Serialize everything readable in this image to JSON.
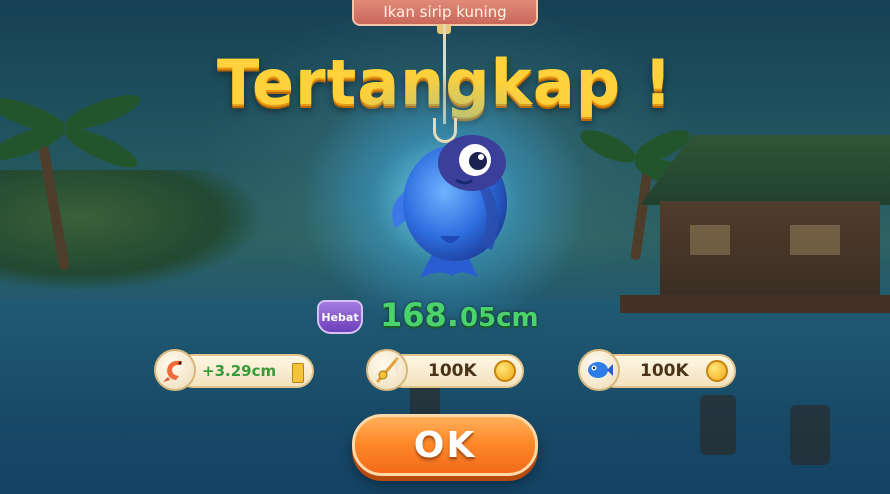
{
  "fish_name": "Ikan sirip kuning",
  "headline": "Tertangkap !",
  "rarity_badge": "Hebat",
  "length": {
    "integer": "168.",
    "decimal": "05cm"
  },
  "rewards": {
    "bait": {
      "icon": "shrimp-icon",
      "value": "+3.29cm"
    },
    "rod": {
      "icon": "fishing-rod-icon",
      "value": "100K"
    },
    "fish": {
      "icon": "blue-fish-icon",
      "value": "100K"
    }
  },
  "ok_button": "OK",
  "colors": {
    "headline": "#ffd13a",
    "length": "#4bd36b",
    "ok_button": "#ff8a2a",
    "badge": "#7c4fc9"
  }
}
